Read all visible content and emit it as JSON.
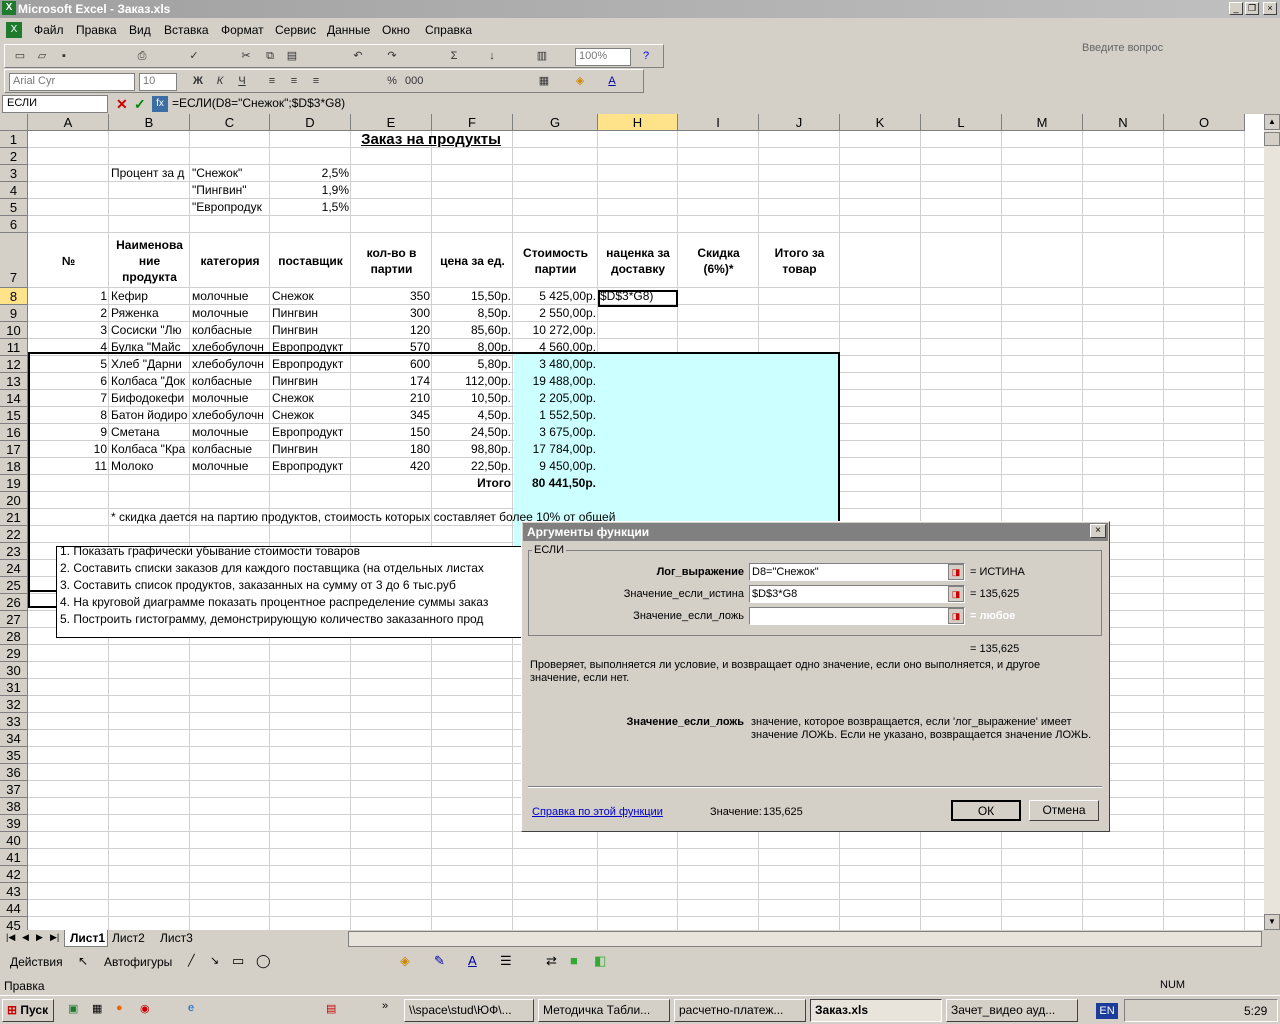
{
  "window": {
    "title": "Microsoft Excel - Заказ.xls",
    "help_placeholder": "Введите вопрос"
  },
  "menu": [
    "Файл",
    "Правка",
    "Вид",
    "Вставка",
    "Формат",
    "Сервис",
    "Данные",
    "Окно",
    "Справка"
  ],
  "toolbar": {
    "zoom": "100%",
    "font": "Arial Cyr",
    "size": "10"
  },
  "formula_bar": {
    "name_box": "ЕСЛИ",
    "formula": "=ЕСЛИ(D8=\"Снежок\";$D$3*G8)"
  },
  "columns": [
    "A",
    "B",
    "C",
    "D",
    "E",
    "F",
    "G",
    "H",
    "I",
    "J",
    "K",
    "L",
    "M",
    "N",
    "O"
  ],
  "sheet": {
    "title": "Заказ на продукты",
    "percent_label": "Процент за д",
    "suppliers": [
      {
        "name": "\"Снежок\"",
        "pct": "2,5%"
      },
      {
        "name": "\"Пингвин\"",
        "pct": "1,9%"
      },
      {
        "name": "\"Европродук",
        "pct": "1,5%"
      }
    ],
    "headers": [
      "№",
      "Наименова ние продукта",
      "категория",
      "поставщик",
      "кол-во в партии",
      "цена за ед.",
      "Стоимость партии",
      "наценка за доставку",
      "Скидка (6%)*",
      "Итого за товар"
    ],
    "rows": [
      [
        "1",
        "Кефир",
        "молочные",
        "Снежок",
        "350",
        "15,50р.",
        "5 425,00р.",
        "$D$3*G8)"
      ],
      [
        "2",
        "Ряженка",
        "молочные",
        "Пингвин",
        "300",
        "8,50р.",
        "2 550,00р.",
        ""
      ],
      [
        "3",
        "Сосиски \"Лю",
        "колбасные",
        "Пингвин",
        "120",
        "85,60р.",
        "10 272,00р.",
        ""
      ],
      [
        "4",
        "Булка \"Майс",
        "хлебобулочн",
        "Европродукт",
        "570",
        "8,00р.",
        "4 560,00р.",
        ""
      ],
      [
        "5",
        "Хлеб \"Дарни",
        "хлебобулочн",
        "Европродукт",
        "600",
        "5,80р.",
        "3 480,00р.",
        ""
      ],
      [
        "6",
        "Колбаса \"Док",
        "колбасные",
        "Пингвин",
        "174",
        "112,00р.",
        "19 488,00р.",
        ""
      ],
      [
        "7",
        "Бифодокефи",
        "молочные",
        "Снежок",
        "210",
        "10,50р.",
        "2 205,00р.",
        ""
      ],
      [
        "8",
        "Батон йодиро",
        "хлебобулочн",
        "Снежок",
        "345",
        "4,50р.",
        "1 552,50р.",
        ""
      ],
      [
        "9",
        "Сметана",
        "молочные",
        "Европродукт",
        "150",
        "24,50р.",
        "3 675,00р.",
        ""
      ],
      [
        "10",
        "Колбаса \"Кра",
        "колбасные",
        "Пингвин",
        "180",
        "98,80р.",
        "17 784,00р.",
        ""
      ],
      [
        "11",
        "Молоко",
        "молочные",
        "Европродукт",
        "420",
        "22,50р.",
        "9 450,00р.",
        ""
      ]
    ],
    "total_label": "Итого",
    "total_value": "80 441,50р.",
    "note": "* скидка дается на партию продуктов, стоимость которых составляет более 10% от общей",
    "tasks": [
      "1. Показать графически убывание стоимости товаров",
      "2. Составить списки заказов для каждого поставщика (на отдельных листах",
      "3. Составить список продуктов, заказанных на сумму от 3 до 6 тыс.руб",
      "4. На круговой диаграмме показать процентное распределение суммы заказ",
      "5. Построить гистограмму, демонстрирующую количество заказанного прод"
    ]
  },
  "dialog": {
    "title": "Аргументы функции",
    "group": "ЕСЛИ",
    "args": [
      {
        "label": "Лог_выражение",
        "value": "D8=\"Снежок\"",
        "result": "= ИСТИНА"
      },
      {
        "label": "Значение_если_истина",
        "value": "$D$3*G8",
        "result": "= 135,625"
      },
      {
        "label": "Значение_если_ложь",
        "value": "",
        "result": "= любое"
      }
    ],
    "total": "= 135,625",
    "desc": "Проверяет, выполняется ли условие, и возвращает одно значение, если оно выполняется, и другое значение, если нет.",
    "arg_name": "Значение_если_ложь",
    "arg_desc": "значение, которое возвращается, если 'лог_выражение' имеет значение ЛОЖЬ. Если не указано, возвращается значение ЛОЖЬ.",
    "help_link": "Справка по этой функции",
    "value_label": "Значение:",
    "value": "135,625",
    "ok": "ОК",
    "cancel": "Отмена"
  },
  "sheet_tabs": [
    "Лист1",
    "Лист2",
    "Лист3"
  ],
  "draw": {
    "actions": "Действия",
    "autoshapes": "Автофигуры"
  },
  "status": {
    "mode": "Правка",
    "num": "NUM"
  },
  "taskbar": {
    "start": "Пуск",
    "tasks": [
      "\\\\space\\stud\\ЮФ\\...",
      "Методичка Табли...",
      "расчетно-платеж...",
      "Заказ.xls",
      "Зачет_видео ауд..."
    ],
    "lang": "EN",
    "clock": "5:29"
  }
}
